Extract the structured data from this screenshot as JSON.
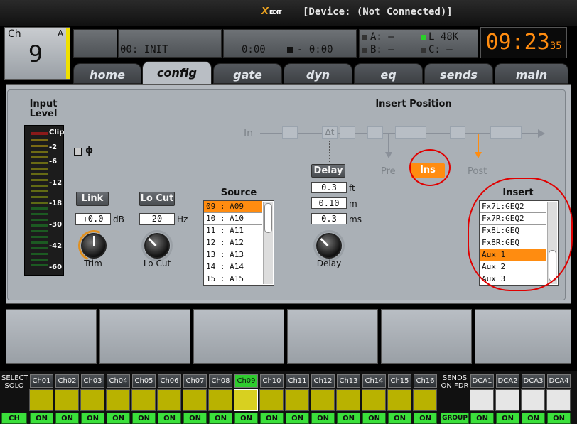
{
  "titlebar": {
    "logo": "X",
    "logo_sub": "EDIT",
    "device": "[Device: (Not Connected)]"
  },
  "channel": {
    "label": "Ch",
    "letter": "A",
    "number": "9"
  },
  "scene": {
    "name": "00: INIT"
  },
  "transport": {
    "start": "0:00",
    "end": "- 0:00"
  },
  "io": {
    "a": "A:  –",
    "b": "B:  –",
    "l": "L   48K",
    "c": "C:  –"
  },
  "clock": {
    "time": "09:23",
    "seconds": "35"
  },
  "tabs": [
    "home",
    "config",
    "gate",
    "dyn",
    "eq",
    "sends",
    "main"
  ],
  "input_level": {
    "title": "Input Level",
    "clip": "Clip",
    "ticks": [
      "-2",
      "-6",
      "-12",
      "-18",
      "-30",
      "-42",
      "-60"
    ]
  },
  "phase": {
    "symbol": "ɸ"
  },
  "link": {
    "label": "Link",
    "value": "+0.0",
    "unit": "dB",
    "knob": "Trim"
  },
  "locut": {
    "label": "Lo Cut",
    "value": "20",
    "unit": "Hz",
    "knob": "Lo Cut"
  },
  "source": {
    "title": "Source",
    "items": [
      "09 : A09",
      "10 : A10",
      "11 : A11",
      "12 : A12",
      "13 : A13",
      "14 : A14",
      "15 : A15"
    ]
  },
  "delay": {
    "label": "Delay",
    "ft": "0.3",
    "ft_unit": "ft",
    "m": "0.10",
    "m_unit": "m",
    "ms": "0.3",
    "ms_unit": "ms",
    "knob": "Delay"
  },
  "insert_position": {
    "title": "Insert Position",
    "in": "In",
    "pre": "Pre",
    "ins": "Ins",
    "post": "Post",
    "delta": "Δt"
  },
  "insert": {
    "title": "Insert",
    "items": [
      "Fx7L:GEQ2",
      "Fx7R:GEQ2",
      "Fx8L:GEQ",
      "Fx8R:GEQ",
      "Aux 1",
      "Aux 2",
      "Aux 3"
    ]
  },
  "strip": {
    "select_label": "SELECT SOLO",
    "ch_label": "CH",
    "sends_label": "SENDS ON FDR",
    "group_label": "GROUP",
    "on_label": "ON",
    "channels": [
      "Ch01",
      "Ch02",
      "Ch03",
      "Ch04",
      "Ch05",
      "Ch06",
      "Ch07",
      "Ch08",
      "Ch09",
      "Ch10",
      "Ch11",
      "Ch12",
      "Ch13",
      "Ch14",
      "Ch15",
      "Ch16"
    ],
    "dcas": [
      "DCA1",
      "DCA2",
      "DCA3",
      "DCA4"
    ]
  },
  "colors": {
    "accent": "#ff8c10",
    "green": "#2ecc2e",
    "yellow": "#f0e000",
    "annotation": "#e00000"
  }
}
